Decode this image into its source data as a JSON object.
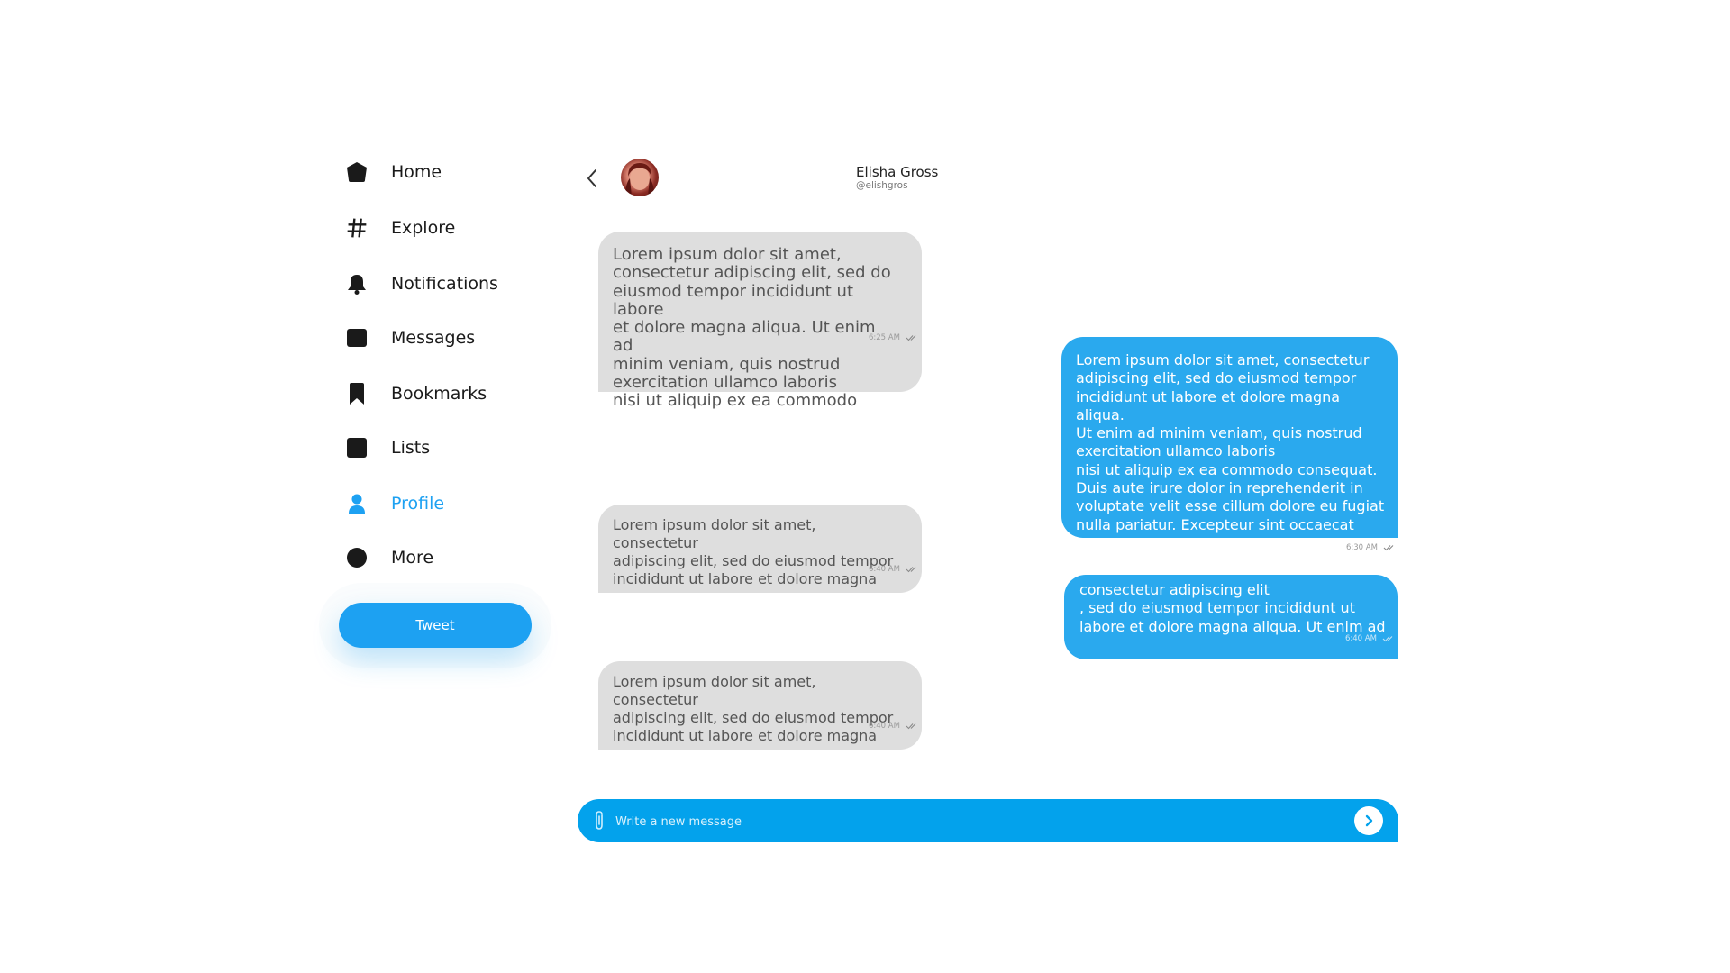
{
  "sidebar": {
    "items": [
      {
        "label": "Home",
        "icon": "home-icon"
      },
      {
        "label": "Explore",
        "icon": "hashtag-icon"
      },
      {
        "label": "Notifications",
        "icon": "bell-icon"
      },
      {
        "label": "Messages",
        "icon": "message-icon"
      },
      {
        "label": "Bookmarks",
        "icon": "bookmark-icon"
      },
      {
        "label": "Lists",
        "icon": "list-icon"
      },
      {
        "label": "Profile",
        "icon": "user-icon",
        "active": true
      },
      {
        "label": "More",
        "icon": "more-icon"
      }
    ],
    "tweet_label": "Tweet"
  },
  "contact": {
    "name": "Elisha Gross",
    "handle": "@elishgros"
  },
  "messages": {
    "in1": {
      "text": "Lorem ipsum dolor sit amet,\nconsectetur adipiscing elit, sed do\neiusmod tempor incididunt ut labore\net dolore magna aliqua. Ut enim ad\nminim veniam, quis nostrud\nexercitation ullamco laboris\n nisi ut aliquip ex ea commodo",
      "time": "6:25 AM"
    },
    "in2": {
      "text": "Lorem ipsum dolor sit amet, consectetur\nadipiscing elit, sed do eiusmod tempor\nincididunt ut labore et dolore magna",
      "time": "6:40 AM"
    },
    "in3": {
      "text": "Lorem ipsum dolor sit amet, consectetur\nadipiscing elit, sed do eiusmod tempor\nincididunt ut labore et dolore magna",
      "time": "6:40 AM"
    },
    "out1": {
      "text": "Lorem ipsum dolor sit amet, consectetur\nadipiscing elit, sed do eiusmod tempor\nincididunt ut labore et dolore magna aliqua.\nUt enim ad minim veniam, quis nostrud\nexercitation ullamco laboris\n nisi ut aliquip ex ea commodo consequat.\nDuis aute irure dolor in reprehenderit in\nvoluptate velit esse cillum dolore eu fugiat\nnulla pariatur. Excepteur sint occaecat",
      "time": "6:30 AM"
    },
    "out2": {
      "text": "consectetur adipiscing elit\n, sed do eiusmod tempor incididunt ut\nlabore et dolore magna aliqua. Ut enim ad",
      "time": "6:40 AM"
    }
  },
  "composer": {
    "placeholder": "Write a new message",
    "value": ""
  },
  "colors": {
    "accent": "#1da1f2",
    "outgoing_bubble": "#2aa9ee",
    "incoming_bubble": "#dedede",
    "composer": "#03a2ec"
  }
}
